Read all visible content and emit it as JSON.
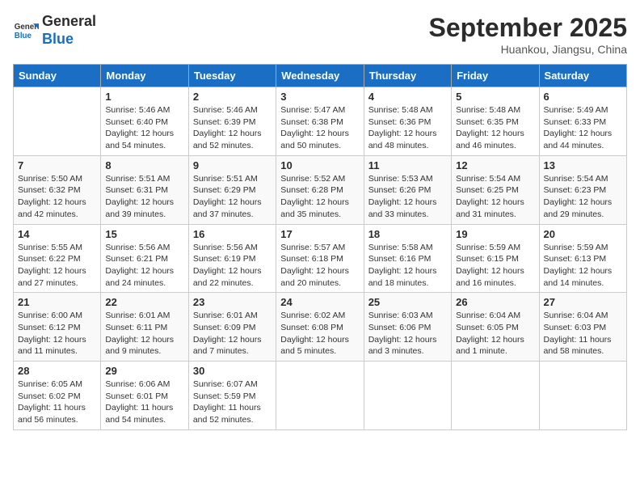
{
  "logo": {
    "line1": "General",
    "line2": "Blue"
  },
  "title": "September 2025",
  "location": "Huankou, Jiangsu, China",
  "days_header": [
    "Sunday",
    "Monday",
    "Tuesday",
    "Wednesday",
    "Thursday",
    "Friday",
    "Saturday"
  ],
  "weeks": [
    [
      {
        "num": "",
        "info": ""
      },
      {
        "num": "1",
        "info": "Sunrise: 5:46 AM\nSunset: 6:40 PM\nDaylight: 12 hours\nand 54 minutes."
      },
      {
        "num": "2",
        "info": "Sunrise: 5:46 AM\nSunset: 6:39 PM\nDaylight: 12 hours\nand 52 minutes."
      },
      {
        "num": "3",
        "info": "Sunrise: 5:47 AM\nSunset: 6:38 PM\nDaylight: 12 hours\nand 50 minutes."
      },
      {
        "num": "4",
        "info": "Sunrise: 5:48 AM\nSunset: 6:36 PM\nDaylight: 12 hours\nand 48 minutes."
      },
      {
        "num": "5",
        "info": "Sunrise: 5:48 AM\nSunset: 6:35 PM\nDaylight: 12 hours\nand 46 minutes."
      },
      {
        "num": "6",
        "info": "Sunrise: 5:49 AM\nSunset: 6:33 PM\nDaylight: 12 hours\nand 44 minutes."
      }
    ],
    [
      {
        "num": "7",
        "info": "Sunrise: 5:50 AM\nSunset: 6:32 PM\nDaylight: 12 hours\nand 42 minutes."
      },
      {
        "num": "8",
        "info": "Sunrise: 5:51 AM\nSunset: 6:31 PM\nDaylight: 12 hours\nand 39 minutes."
      },
      {
        "num": "9",
        "info": "Sunrise: 5:51 AM\nSunset: 6:29 PM\nDaylight: 12 hours\nand 37 minutes."
      },
      {
        "num": "10",
        "info": "Sunrise: 5:52 AM\nSunset: 6:28 PM\nDaylight: 12 hours\nand 35 minutes."
      },
      {
        "num": "11",
        "info": "Sunrise: 5:53 AM\nSunset: 6:26 PM\nDaylight: 12 hours\nand 33 minutes."
      },
      {
        "num": "12",
        "info": "Sunrise: 5:54 AM\nSunset: 6:25 PM\nDaylight: 12 hours\nand 31 minutes."
      },
      {
        "num": "13",
        "info": "Sunrise: 5:54 AM\nSunset: 6:23 PM\nDaylight: 12 hours\nand 29 minutes."
      }
    ],
    [
      {
        "num": "14",
        "info": "Sunrise: 5:55 AM\nSunset: 6:22 PM\nDaylight: 12 hours\nand 27 minutes."
      },
      {
        "num": "15",
        "info": "Sunrise: 5:56 AM\nSunset: 6:21 PM\nDaylight: 12 hours\nand 24 minutes."
      },
      {
        "num": "16",
        "info": "Sunrise: 5:56 AM\nSunset: 6:19 PM\nDaylight: 12 hours\nand 22 minutes."
      },
      {
        "num": "17",
        "info": "Sunrise: 5:57 AM\nSunset: 6:18 PM\nDaylight: 12 hours\nand 20 minutes."
      },
      {
        "num": "18",
        "info": "Sunrise: 5:58 AM\nSunset: 6:16 PM\nDaylight: 12 hours\nand 18 minutes."
      },
      {
        "num": "19",
        "info": "Sunrise: 5:59 AM\nSunset: 6:15 PM\nDaylight: 12 hours\nand 16 minutes."
      },
      {
        "num": "20",
        "info": "Sunrise: 5:59 AM\nSunset: 6:13 PM\nDaylight: 12 hours\nand 14 minutes."
      }
    ],
    [
      {
        "num": "21",
        "info": "Sunrise: 6:00 AM\nSunset: 6:12 PM\nDaylight: 12 hours\nand 11 minutes."
      },
      {
        "num": "22",
        "info": "Sunrise: 6:01 AM\nSunset: 6:11 PM\nDaylight: 12 hours\nand 9 minutes."
      },
      {
        "num": "23",
        "info": "Sunrise: 6:01 AM\nSunset: 6:09 PM\nDaylight: 12 hours\nand 7 minutes."
      },
      {
        "num": "24",
        "info": "Sunrise: 6:02 AM\nSunset: 6:08 PM\nDaylight: 12 hours\nand 5 minutes."
      },
      {
        "num": "25",
        "info": "Sunrise: 6:03 AM\nSunset: 6:06 PM\nDaylight: 12 hours\nand 3 minutes."
      },
      {
        "num": "26",
        "info": "Sunrise: 6:04 AM\nSunset: 6:05 PM\nDaylight: 12 hours\nand 1 minute."
      },
      {
        "num": "27",
        "info": "Sunrise: 6:04 AM\nSunset: 6:03 PM\nDaylight: 11 hours\nand 58 minutes."
      }
    ],
    [
      {
        "num": "28",
        "info": "Sunrise: 6:05 AM\nSunset: 6:02 PM\nDaylight: 11 hours\nand 56 minutes."
      },
      {
        "num": "29",
        "info": "Sunrise: 6:06 AM\nSunset: 6:01 PM\nDaylight: 11 hours\nand 54 minutes."
      },
      {
        "num": "30",
        "info": "Sunrise: 6:07 AM\nSunset: 5:59 PM\nDaylight: 11 hours\nand 52 minutes."
      },
      {
        "num": "",
        "info": ""
      },
      {
        "num": "",
        "info": ""
      },
      {
        "num": "",
        "info": ""
      },
      {
        "num": "",
        "info": ""
      }
    ]
  ]
}
